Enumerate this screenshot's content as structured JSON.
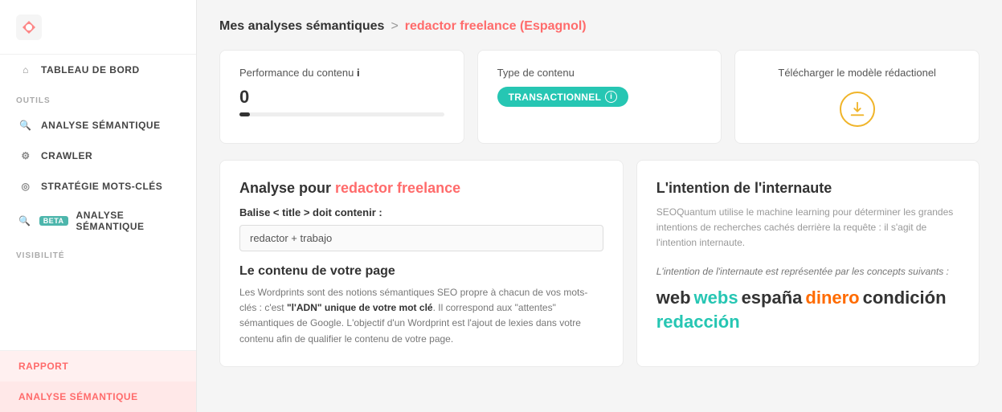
{
  "sidebar": {
    "home_label": "TABLEAU DE BORD",
    "section_outils": "OUTILS",
    "item_analyse_semantique": "ANALYSE SÉMANTIQUE",
    "item_crawler": "CRAWLER",
    "item_strategie": "STRATÉGIE MOTS-CLÉS",
    "item_analyse_semantique_beta": "ANALYSE SÉMANTIQUE",
    "beta_badge": "BETA",
    "section_visibilite": "VISIBILITÉ",
    "item_rapport": "RAPPORT",
    "item_analyse_bottom": "ANALYSE SÉMANTIQUE"
  },
  "header": {
    "breadcrumb_root": "Mes analyses sémantiques",
    "breadcrumb_separator": ">",
    "breadcrumb_current": "redactor freelance (Espagnol)"
  },
  "cards": {
    "perf_title": "Performance du contenu",
    "perf_info": "i",
    "perf_value": "0",
    "type_title": "Type de contenu",
    "type_badge": "TRANSACTIONNEL",
    "type_badge_info": "i",
    "download_title": "Télécharger le modèle rédactionel"
  },
  "panel_left": {
    "title_prefix": "Analyse pour ",
    "title_highlight": "redactor freelance",
    "balise_label": "Balise < title > doit contenir :",
    "balise_value": "redactor + trabajo",
    "section_title": "Le contenu de votre page",
    "section_desc_1": "Les Wordprints sont des notions sémantiques SEO propre à chacun de vos mots-clés : c'est ",
    "section_desc_bold": "\"l'ADN\" unique de votre mot clé",
    "section_desc_2": ". Il correspond aux \"attentes\" sémantiques de Google. L'objectif d'un Wordprint est l'ajout de lexies dans votre contenu afin de qualifier le contenu de votre page."
  },
  "panel_right": {
    "title": "L'intention de l'internaute",
    "desc": "SEOQuantum utilise le machine learning pour déterminer les grandes intentions de recherches cachés derrière la requête : il s'agit de l'intention internaute.",
    "intention_label": "L'intention de l'internaute est représentée par les concepts suivants :",
    "concepts": [
      {
        "text": "web",
        "style": "dark"
      },
      {
        "text": "webs",
        "style": "teal"
      },
      {
        "text": "españa",
        "style": "dark"
      },
      {
        "text": "dinero",
        "style": "orange"
      },
      {
        "text": "condición",
        "style": "dark"
      },
      {
        "text": "redacción",
        "style": "teal"
      }
    ]
  }
}
